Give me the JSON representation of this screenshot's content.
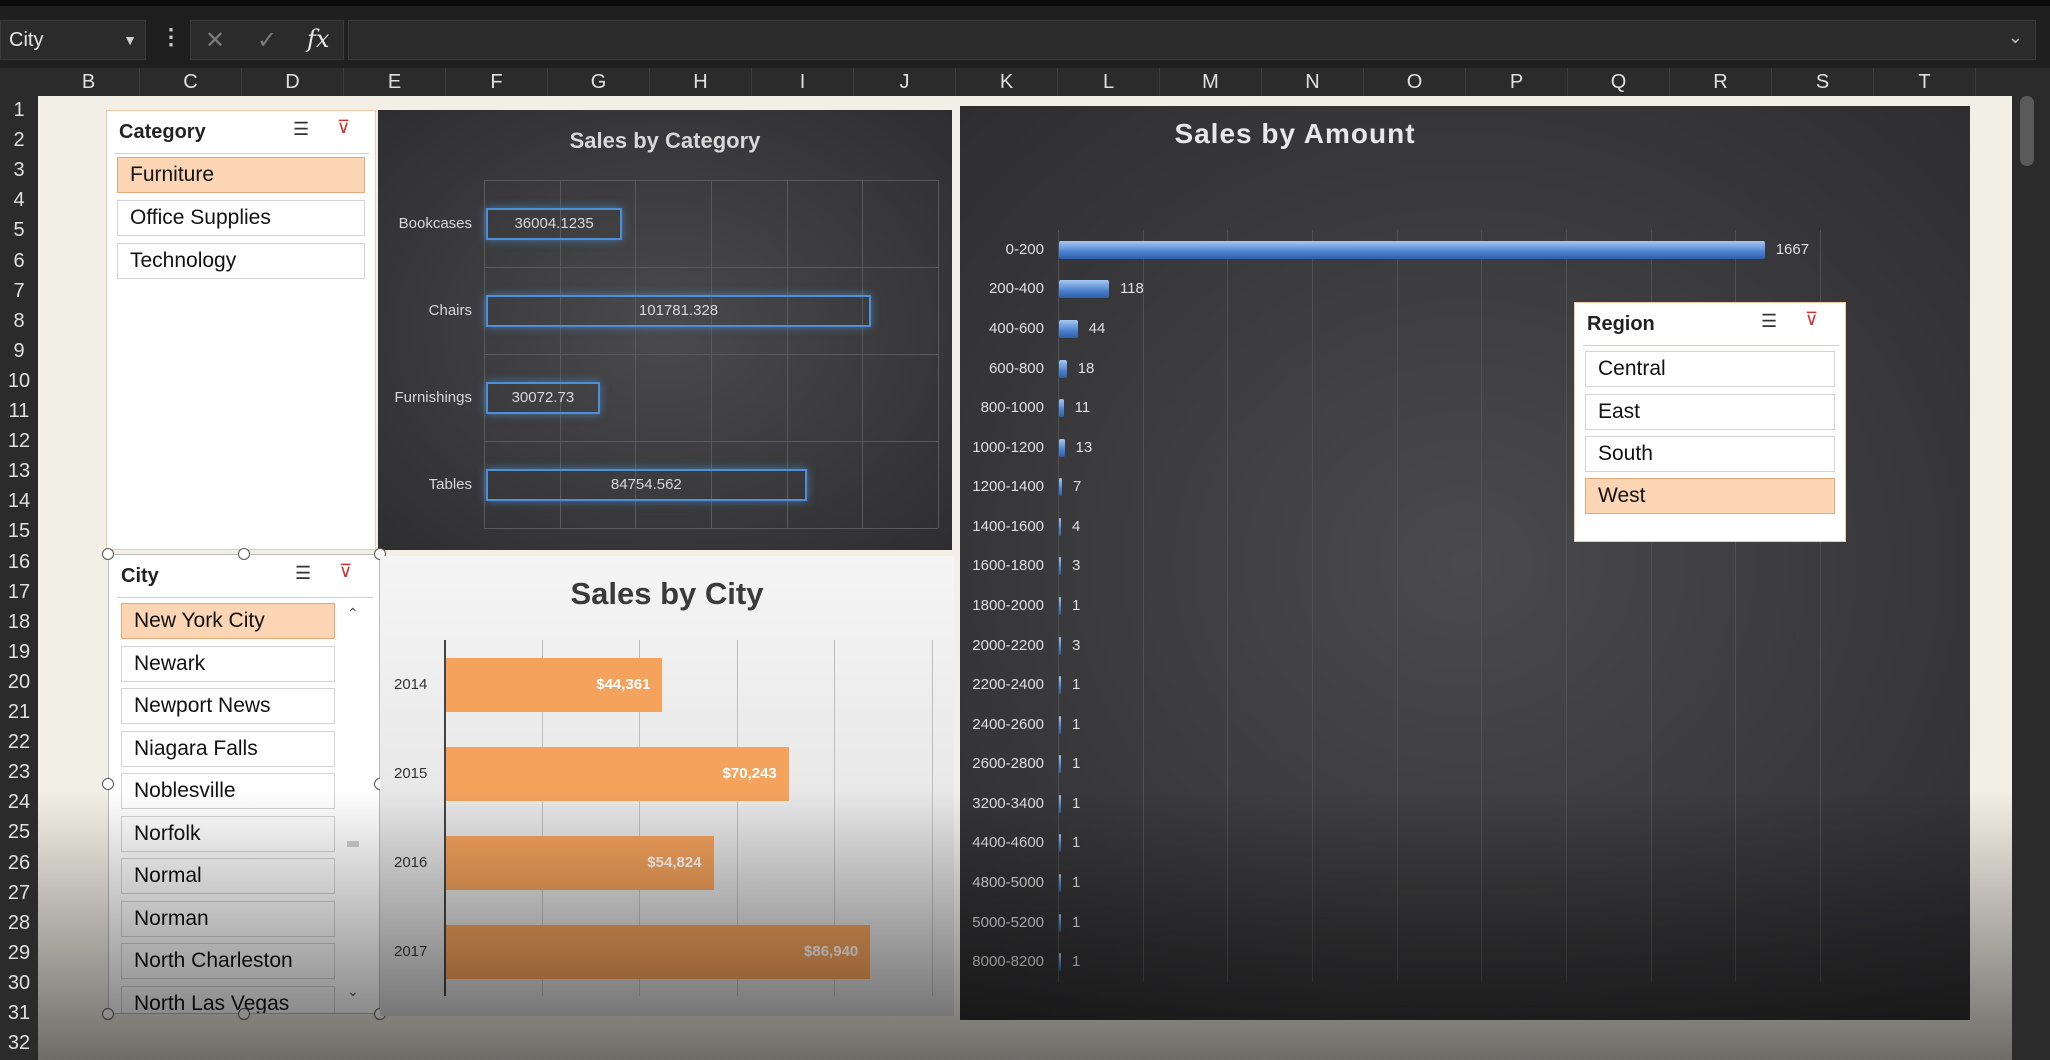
{
  "formula_bar": {
    "name_box": "City",
    "cancel_icon": "✕",
    "enter_icon": "✓",
    "fx_label": "fx",
    "expand_icon": "⌄"
  },
  "columns": [
    "B",
    "C",
    "D",
    "E",
    "F",
    "G",
    "H",
    "I",
    "J",
    "K",
    "L",
    "M",
    "N",
    "O",
    "P",
    "Q",
    "R",
    "S",
    "T"
  ],
  "rows": [
    "1",
    "2",
    "3",
    "4",
    "5",
    "6",
    "7",
    "8",
    "9",
    "10",
    "11",
    "12",
    "13",
    "14",
    "15",
    "16",
    "17",
    "18",
    "19",
    "20",
    "21",
    "22",
    "23",
    "24",
    "25",
    "26",
    "27",
    "28",
    "29",
    "30",
    "31",
    "32"
  ],
  "slicers": {
    "category": {
      "title": "Category",
      "items": [
        "Furniture",
        "Office Supplies",
        "Technology"
      ],
      "selected": "Furniture"
    },
    "city": {
      "title": "City",
      "items": [
        "New York City",
        "Newark",
        "Newport News",
        "Niagara Falls",
        "Noblesville",
        "Norfolk",
        "Normal",
        "Norman",
        "North Charleston",
        "North Las Vegas"
      ],
      "selected": "New York City"
    },
    "region": {
      "title": "Region",
      "items": [
        "Central",
        "East",
        "South",
        "West"
      ],
      "selected": "West"
    }
  },
  "chart_data": [
    {
      "type": "bar",
      "title": "Sales by Category",
      "categories": [
        "Bookcases",
        "Chairs",
        "Furnishings",
        "Tables"
      ],
      "values": [
        36004.1235,
        101781.328,
        30072.73,
        84754.562
      ],
      "value_labels": [
        "36004.1235",
        "101781.328",
        "30072.73",
        "84754.562"
      ],
      "xlim": [
        0,
        120000
      ],
      "grid": true,
      "colors": {
        "bar_border": "#4f8fd8",
        "background": "#3a3a3c"
      }
    },
    {
      "type": "bar",
      "title": "Sales by City",
      "categories": [
        "2014",
        "2015",
        "2016",
        "2017"
      ],
      "values": [
        44361,
        70243,
        54824,
        86940
      ],
      "value_labels": [
        "$44,361",
        "$70,243",
        "$54,824",
        "$86,940"
      ],
      "xlim": [
        0,
        100000
      ],
      "grid": true,
      "colors": {
        "bar": "#f4a25c",
        "background": "#eeeeee"
      }
    },
    {
      "type": "bar",
      "title": "Sales by Amount",
      "categories": [
        "0-200",
        "200-400",
        "400-600",
        "600-800",
        "800-1000",
        "1000-1200",
        "1200-1400",
        "1400-1600",
        "1600-1800",
        "1800-2000",
        "2000-2200",
        "2200-2400",
        "2400-2600",
        "2600-2800",
        "3200-3400",
        "4400-4600",
        "4800-5000",
        "5000-5200",
        "8000-8200"
      ],
      "values": [
        1667,
        118,
        44,
        18,
        11,
        13,
        7,
        4,
        3,
        1,
        3,
        1,
        1,
        1,
        1,
        1,
        1,
        1,
        1
      ],
      "value_labels": [
        "1667",
        "118",
        "44",
        "18",
        "11",
        "13",
        "7",
        "4",
        "3",
        "1",
        "3",
        "1",
        "1",
        "1",
        "1",
        "1",
        "1",
        "1",
        "1"
      ],
      "xlim": [
        0,
        1800
      ],
      "grid": true,
      "colors": {
        "bar": "#6a9de0",
        "background": "#333335"
      }
    }
  ]
}
